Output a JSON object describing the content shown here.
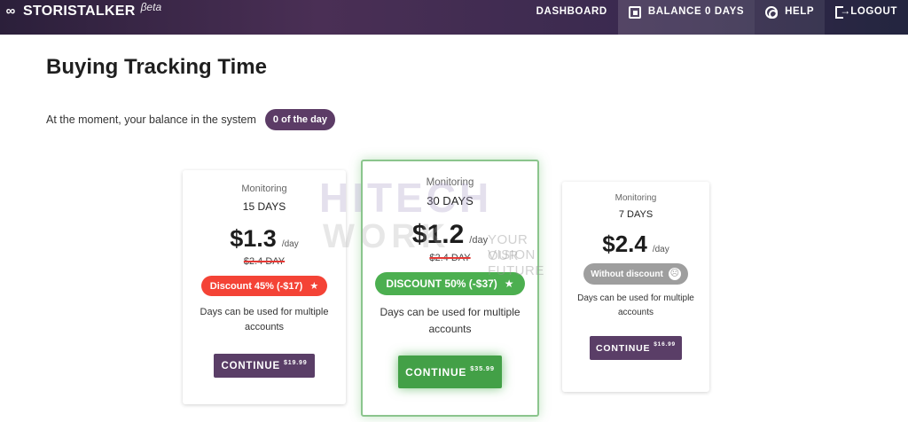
{
  "brand": {
    "icon": "infinity-icon",
    "name": "STORISTALKER",
    "beta": "βeta"
  },
  "nav": [
    {
      "label": "DASHBOARD",
      "icon": "dashboard-icon"
    },
    {
      "label": "BALANCE 0 DAYS",
      "icon": "balance-icon"
    },
    {
      "label": "HELP",
      "icon": "help-icon"
    },
    {
      "label": "LOGOUT",
      "icon": "logout-icon"
    }
  ],
  "page": {
    "title": "Buying Tracking Time",
    "balance_text": "At the moment, your balance in the system",
    "balance_chip": "0 of the day"
  },
  "plans": [
    {
      "monitoring": "Monitoring",
      "days": "15 DAYS",
      "price": "$1.3",
      "per": "/day",
      "old_price": "$2.4 DAY",
      "badge": "Discount 45% (-$17)",
      "description": "Days can be used for multiple accounts",
      "button": "CONTINUE",
      "button_price": "$19.99"
    },
    {
      "monitoring": "Monitoring",
      "days": "30 DAYS",
      "price": "$1.2",
      "per": "/day",
      "old_price": "$2.4 DAY",
      "badge": "DISCOUNT 50% (-$37)",
      "description": "Days can be used for multiple accounts",
      "button": "CONTINUE",
      "button_price": "$35.99"
    },
    {
      "monitoring": "Monitoring",
      "days": "7 DAYS",
      "price": "$2.4",
      "per": "/day",
      "badge": "Without discount",
      "description": "Days can be used for multiple accounts",
      "button": "CONTINUE",
      "button_price": "$16.99"
    }
  ],
  "watermark": {
    "line1": "HITECH",
    "line2": "WORK",
    "tag1": "YOUR VISION",
    "tag2": "OUR FUTURE"
  },
  "colors": {
    "accent_purple": "#5a3e67",
    "discount_red": "#f44336",
    "discount_green": "#4caf50",
    "neutral_gray": "#9e9e9e"
  }
}
